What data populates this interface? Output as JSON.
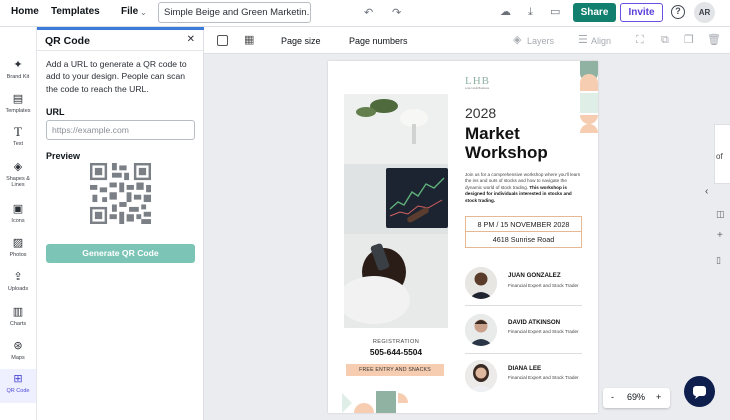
{
  "topbar": {
    "home": "Home",
    "templates": "Templates",
    "file": "File",
    "doc_title": "Simple Beige and Green Marketin...",
    "share": "Share",
    "invite": "Invite",
    "help": "?",
    "avatar_initials": "AR"
  },
  "rail": [
    {
      "label": "Brand Kit",
      "icon": "magic-wand-icon"
    },
    {
      "label": "Templates",
      "icon": "templates-icon"
    },
    {
      "label": "Text",
      "icon": "text-icon"
    },
    {
      "label": "Shapes & Lines",
      "icon": "shapes-icon"
    },
    {
      "label": "Icons",
      "icon": "briefcase-icon"
    },
    {
      "label": "Photos",
      "icon": "image-icon"
    },
    {
      "label": "Uploads",
      "icon": "upload-icon"
    },
    {
      "label": "Charts",
      "icon": "chart-icon"
    },
    {
      "label": "Maps",
      "icon": "map-icon"
    },
    {
      "label": "QR Code",
      "icon": "qr-code-icon"
    }
  ],
  "panel": {
    "title": "QR Code",
    "description": "Add a URL to generate a QR code to add to your design. People can scan the code to reach the URL.",
    "url_label": "URL",
    "url_placeholder": "https://example.com",
    "preview_label": "Preview",
    "generate_button": "Generate QR Code"
  },
  "editor_toolbar": {
    "page_size": "Page size",
    "page_numbers": "Page numbers",
    "layers": "Layers",
    "align": "Align"
  },
  "design": {
    "logo": "LHB",
    "logo_sub": "Lorem Hub Business",
    "year": "2028",
    "title_line1": "Market",
    "title_line2": "Workshop",
    "description_plain": "Join us for a comprehensive workshop where you'll learn the ins and outs of stocks and how to navigate the dynamic world of stock trading.",
    "description_bold": "This workshop is designed for individuals interested in stocks and stock trading.",
    "date": "8 PM / 15 NOVEMBER 2028",
    "address": "4618 Sunrise Road",
    "registration_label": "REGISTRATION",
    "phone": "505-644-5504",
    "free_entry": "FREE ENTRY AND SNACKS",
    "speakers": [
      {
        "name": "JUAN GONZALEZ",
        "role": "Financial Expert and Stock Trader"
      },
      {
        "name": "DAVID ATKINSON",
        "role": "Financial Expert and Stock Trader"
      },
      {
        "name": "DIANA LEE",
        "role": "Financial Expert and Stock Trader"
      }
    ],
    "colors": {
      "green": "#8fb2a3",
      "peach": "#f6cdb1",
      "orange": "#e7b892"
    }
  },
  "zoom": {
    "minus": "-",
    "value": "69%",
    "plus": "+"
  },
  "right_edge": {
    "text": "of"
  }
}
